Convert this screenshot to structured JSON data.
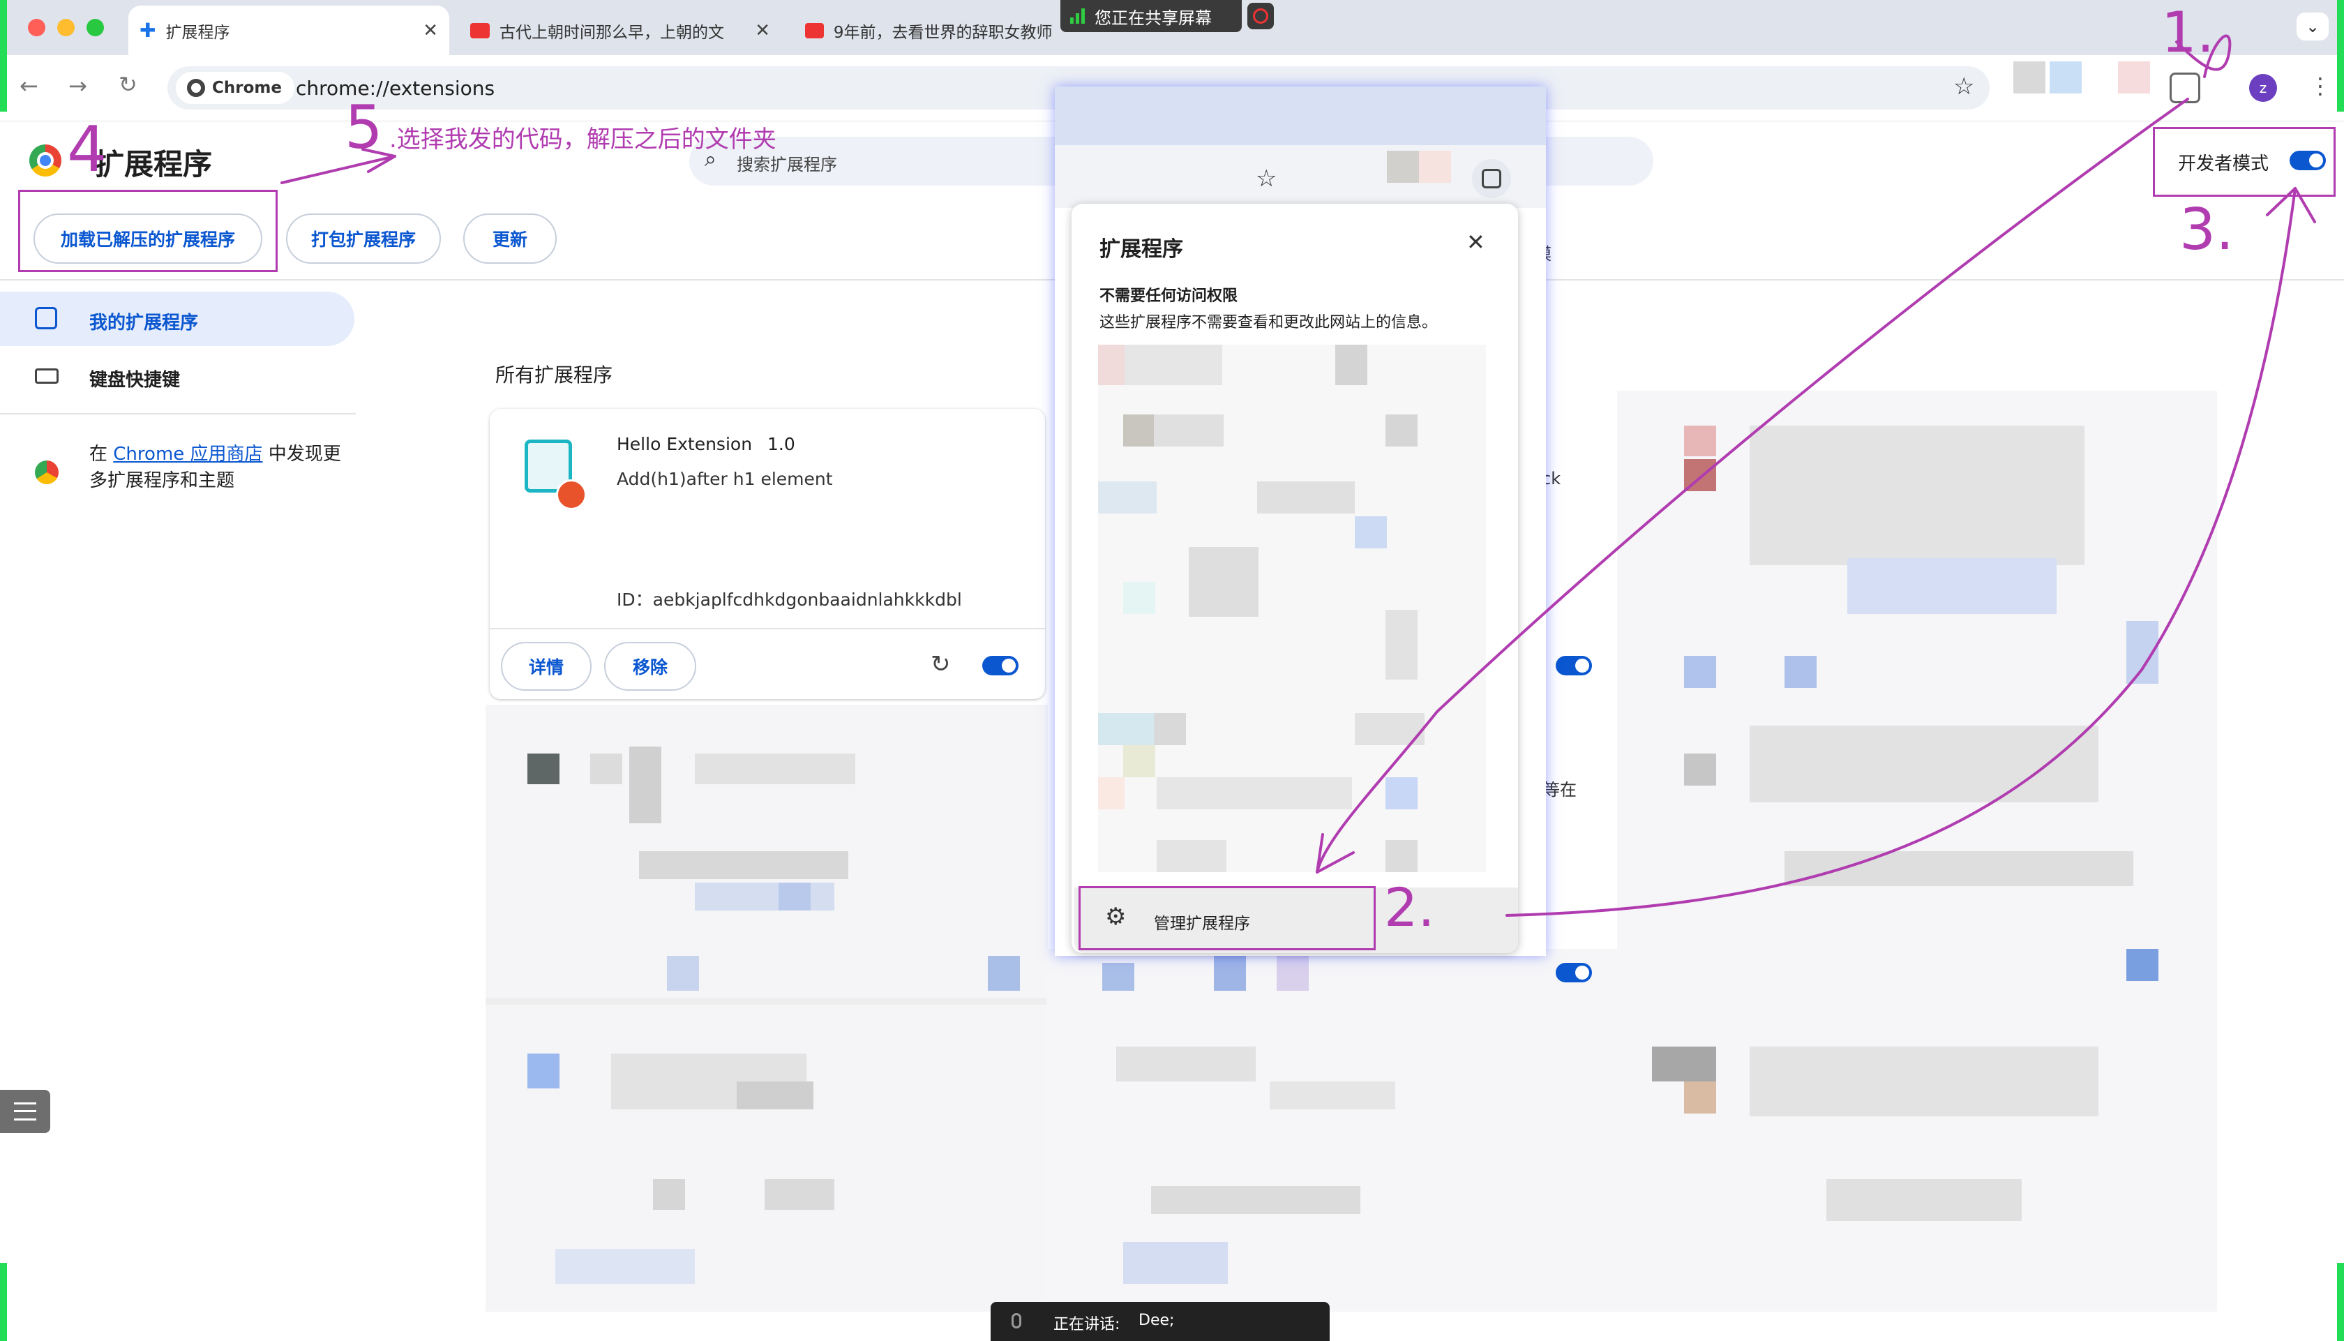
{
  "browser": {
    "tabs": [
      {
        "title": "扩展程序",
        "favicon": "puzzle-icon"
      },
      {
        "title": "古代上朝时间那么早，上朝的文",
        "favicon": "toutiao-icon"
      },
      {
        "title": "9年前，去看世界的辞职女教师",
        "favicon": "toutiao-icon"
      }
    ],
    "omnibox_chip": "Chrome",
    "url": "chrome://extensions",
    "profile_initial": "z"
  },
  "screen_share": {
    "banner": "您正在共享屏幕",
    "speaking_label": "正在讲话:",
    "speaker": "Dee;"
  },
  "page": {
    "title": "扩展程序",
    "search_placeholder": "搜索扩展程序",
    "dev_mode_label": "开发者模式",
    "dev_mode_on": true,
    "buttons": {
      "load_unpacked": "加载已解压的扩展程序",
      "pack": "打包扩展程序",
      "update": "更新"
    },
    "sidebar": {
      "my_extensions": "我的扩展程序",
      "shortcuts": "键盘快捷键",
      "store_prefix": "在",
      "store_link": "Chrome 应用商店",
      "store_suffix": "中发现更多扩展程序和主题"
    },
    "section_title": "所有扩展程序",
    "extension": {
      "name": "Hello Extension",
      "version": "1.0",
      "description": "Add(h1)after h1 element",
      "id_label": "ID：",
      "id": "aebkjaplfcdhkdgonbaaidnlahkkkdbl",
      "details": "详情",
      "remove": "移除",
      "enabled": true
    },
    "partial_text": {
      "a": "者模",
      "b": "ck",
      "c": "等在"
    }
  },
  "popup": {
    "title": "扩展程序",
    "section_heading": "不需要任何访问权限",
    "section_desc": "这些扩展程序不需要查看和更改此网站上的信息。",
    "manage_label": "管理扩展程序"
  },
  "annotations": {
    "step1": "1.",
    "step2": "2.",
    "step3": "3.",
    "step4": "4",
    "step5_num": "5",
    "step5_text": ".选择我发的代码，解压之后的文件夹"
  },
  "colors": {
    "accent": "#0b57d0",
    "annotation": "#b03cb0",
    "tabbar": "#dfe3eb"
  }
}
